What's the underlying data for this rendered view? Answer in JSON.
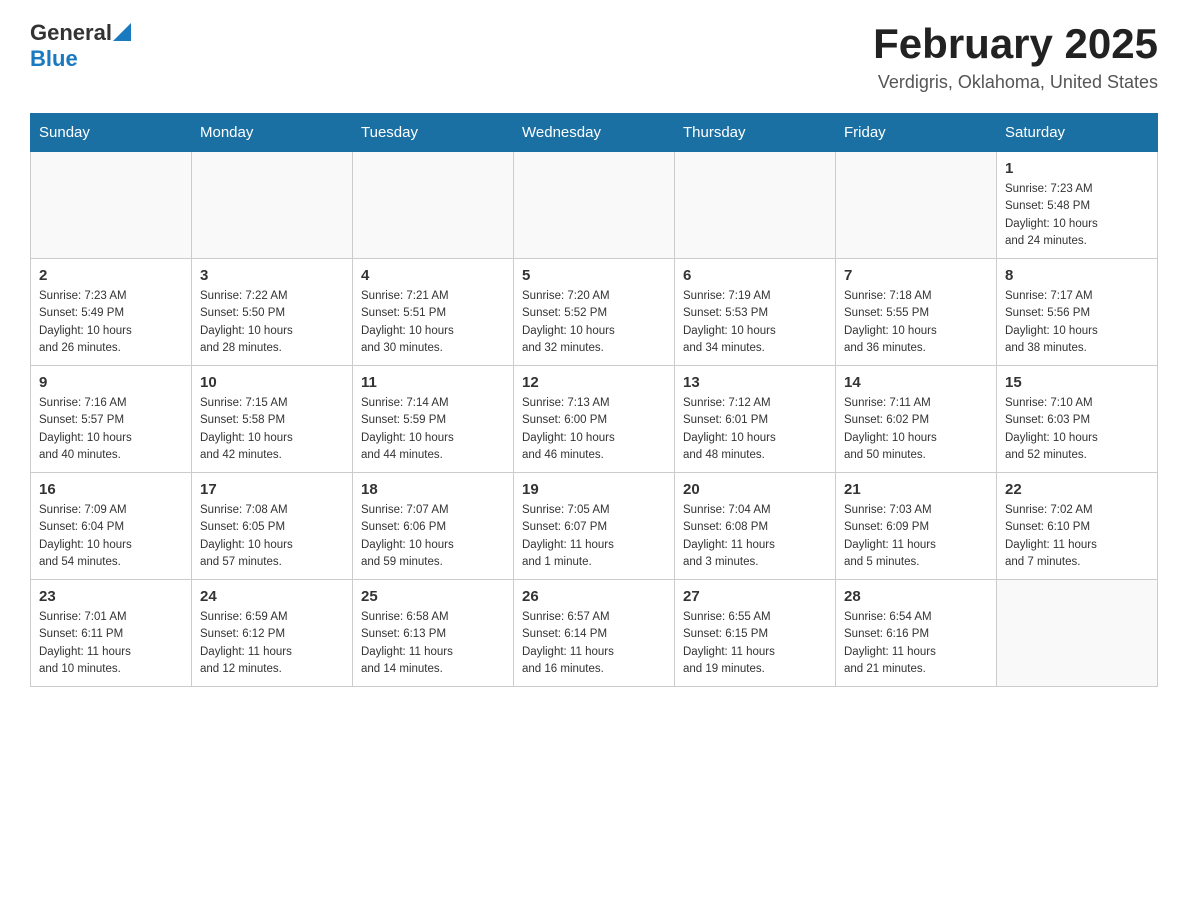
{
  "header": {
    "logo": {
      "general": "General",
      "blue": "Blue"
    },
    "title": "February 2025",
    "subtitle": "Verdigris, Oklahoma, United States"
  },
  "weekdays": [
    "Sunday",
    "Monday",
    "Tuesday",
    "Wednesday",
    "Thursday",
    "Friday",
    "Saturday"
  ],
  "weeks": [
    {
      "days": [
        {
          "number": "",
          "info": ""
        },
        {
          "number": "",
          "info": ""
        },
        {
          "number": "",
          "info": ""
        },
        {
          "number": "",
          "info": ""
        },
        {
          "number": "",
          "info": ""
        },
        {
          "number": "",
          "info": ""
        },
        {
          "number": "1",
          "info": "Sunrise: 7:23 AM\nSunset: 5:48 PM\nDaylight: 10 hours\nand 24 minutes."
        }
      ]
    },
    {
      "days": [
        {
          "number": "2",
          "info": "Sunrise: 7:23 AM\nSunset: 5:49 PM\nDaylight: 10 hours\nand 26 minutes."
        },
        {
          "number": "3",
          "info": "Sunrise: 7:22 AM\nSunset: 5:50 PM\nDaylight: 10 hours\nand 28 minutes."
        },
        {
          "number": "4",
          "info": "Sunrise: 7:21 AM\nSunset: 5:51 PM\nDaylight: 10 hours\nand 30 minutes."
        },
        {
          "number": "5",
          "info": "Sunrise: 7:20 AM\nSunset: 5:52 PM\nDaylight: 10 hours\nand 32 minutes."
        },
        {
          "number": "6",
          "info": "Sunrise: 7:19 AM\nSunset: 5:53 PM\nDaylight: 10 hours\nand 34 minutes."
        },
        {
          "number": "7",
          "info": "Sunrise: 7:18 AM\nSunset: 5:55 PM\nDaylight: 10 hours\nand 36 minutes."
        },
        {
          "number": "8",
          "info": "Sunrise: 7:17 AM\nSunset: 5:56 PM\nDaylight: 10 hours\nand 38 minutes."
        }
      ]
    },
    {
      "days": [
        {
          "number": "9",
          "info": "Sunrise: 7:16 AM\nSunset: 5:57 PM\nDaylight: 10 hours\nand 40 minutes."
        },
        {
          "number": "10",
          "info": "Sunrise: 7:15 AM\nSunset: 5:58 PM\nDaylight: 10 hours\nand 42 minutes."
        },
        {
          "number": "11",
          "info": "Sunrise: 7:14 AM\nSunset: 5:59 PM\nDaylight: 10 hours\nand 44 minutes."
        },
        {
          "number": "12",
          "info": "Sunrise: 7:13 AM\nSunset: 6:00 PM\nDaylight: 10 hours\nand 46 minutes."
        },
        {
          "number": "13",
          "info": "Sunrise: 7:12 AM\nSunset: 6:01 PM\nDaylight: 10 hours\nand 48 minutes."
        },
        {
          "number": "14",
          "info": "Sunrise: 7:11 AM\nSunset: 6:02 PM\nDaylight: 10 hours\nand 50 minutes."
        },
        {
          "number": "15",
          "info": "Sunrise: 7:10 AM\nSunset: 6:03 PM\nDaylight: 10 hours\nand 52 minutes."
        }
      ]
    },
    {
      "days": [
        {
          "number": "16",
          "info": "Sunrise: 7:09 AM\nSunset: 6:04 PM\nDaylight: 10 hours\nand 54 minutes."
        },
        {
          "number": "17",
          "info": "Sunrise: 7:08 AM\nSunset: 6:05 PM\nDaylight: 10 hours\nand 57 minutes."
        },
        {
          "number": "18",
          "info": "Sunrise: 7:07 AM\nSunset: 6:06 PM\nDaylight: 10 hours\nand 59 minutes."
        },
        {
          "number": "19",
          "info": "Sunrise: 7:05 AM\nSunset: 6:07 PM\nDaylight: 11 hours\nand 1 minute."
        },
        {
          "number": "20",
          "info": "Sunrise: 7:04 AM\nSunset: 6:08 PM\nDaylight: 11 hours\nand 3 minutes."
        },
        {
          "number": "21",
          "info": "Sunrise: 7:03 AM\nSunset: 6:09 PM\nDaylight: 11 hours\nand 5 minutes."
        },
        {
          "number": "22",
          "info": "Sunrise: 7:02 AM\nSunset: 6:10 PM\nDaylight: 11 hours\nand 7 minutes."
        }
      ]
    },
    {
      "days": [
        {
          "number": "23",
          "info": "Sunrise: 7:01 AM\nSunset: 6:11 PM\nDaylight: 11 hours\nand 10 minutes."
        },
        {
          "number": "24",
          "info": "Sunrise: 6:59 AM\nSunset: 6:12 PM\nDaylight: 11 hours\nand 12 minutes."
        },
        {
          "number": "25",
          "info": "Sunrise: 6:58 AM\nSunset: 6:13 PM\nDaylight: 11 hours\nand 14 minutes."
        },
        {
          "number": "26",
          "info": "Sunrise: 6:57 AM\nSunset: 6:14 PM\nDaylight: 11 hours\nand 16 minutes."
        },
        {
          "number": "27",
          "info": "Sunrise: 6:55 AM\nSunset: 6:15 PM\nDaylight: 11 hours\nand 19 minutes."
        },
        {
          "number": "28",
          "info": "Sunrise: 6:54 AM\nSunset: 6:16 PM\nDaylight: 11 hours\nand 21 minutes."
        },
        {
          "number": "",
          "info": ""
        }
      ]
    }
  ]
}
